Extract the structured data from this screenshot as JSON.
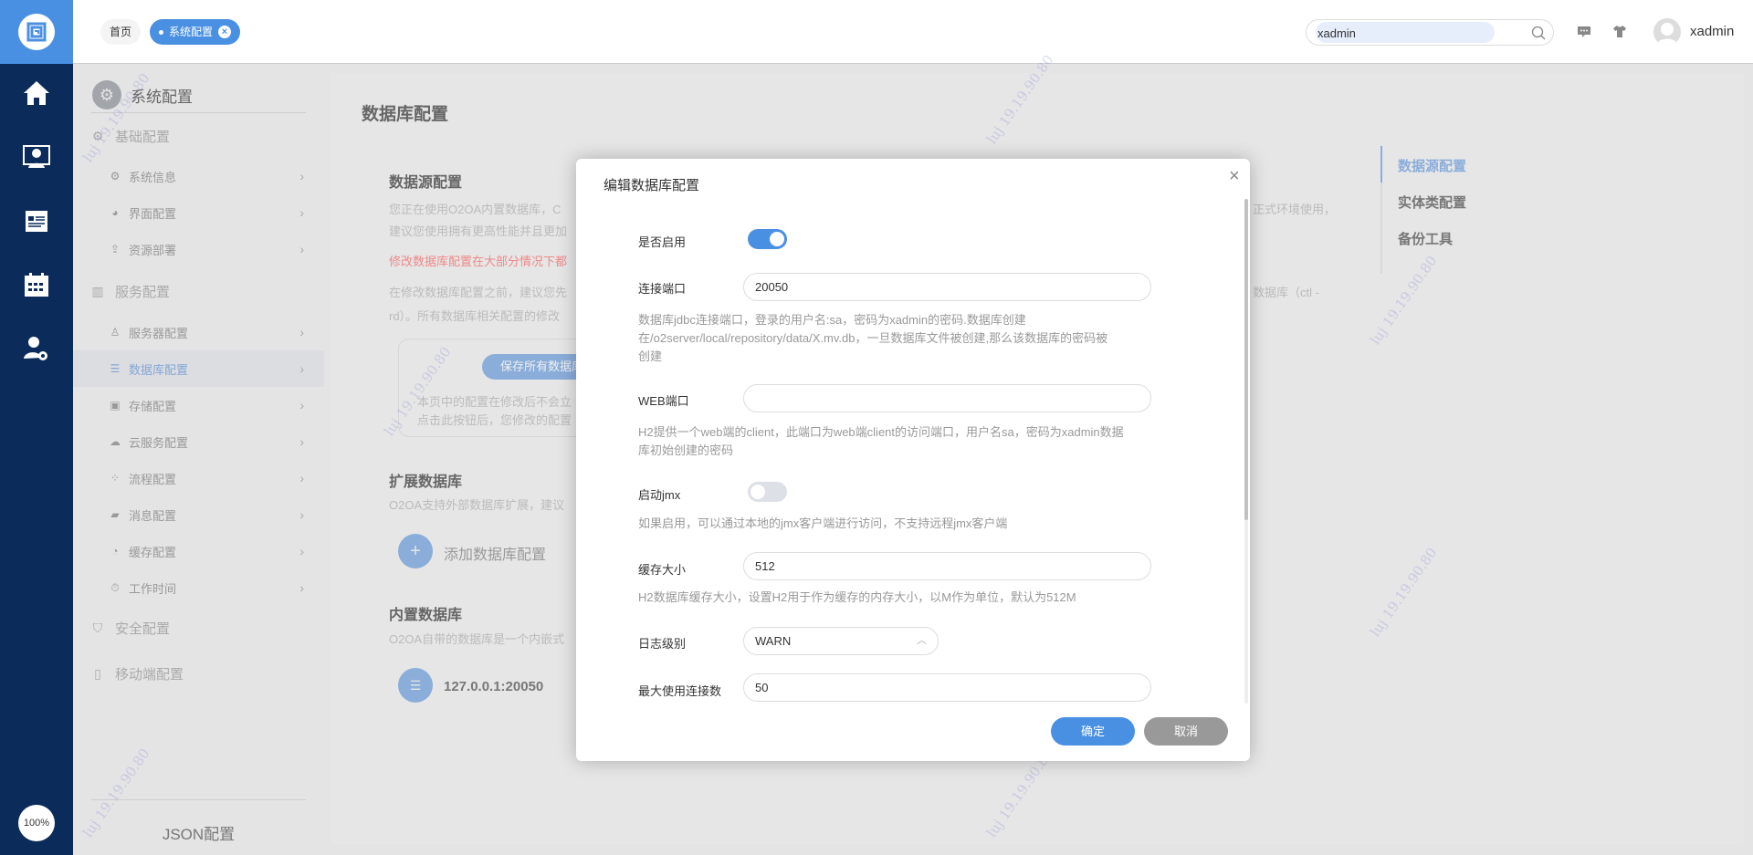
{
  "app": {
    "zoom_label": "100%",
    "watermark": "luj 19.19.90.80"
  },
  "topbar": {
    "tabs": [
      {
        "label": "首页"
      },
      {
        "label": "系统配置"
      }
    ],
    "search": {
      "value": "xadmin"
    },
    "user": {
      "name": "xadmin"
    }
  },
  "leftnav": {
    "icons": [
      "home-icon",
      "user-screen-icon",
      "news-icon",
      "calendar-icon",
      "user-settings-icon"
    ]
  },
  "sidebar": {
    "title": "系统配置",
    "groups": [
      {
        "label": "基础配置",
        "items": [
          {
            "label": "系统信息"
          },
          {
            "label": "界面配置"
          },
          {
            "label": "资源部署"
          }
        ]
      },
      {
        "label": "服务配置",
        "items": [
          {
            "label": "服务器配置"
          },
          {
            "label": "数据库配置",
            "active": true
          },
          {
            "label": "存储配置"
          },
          {
            "label": "云服务配置"
          },
          {
            "label": "流程配置"
          },
          {
            "label": "消息配置"
          },
          {
            "label": "缓存配置"
          },
          {
            "label": "工作时间"
          }
        ]
      },
      {
        "label": "安全配置"
      },
      {
        "label": "移动端配置"
      }
    ],
    "json_config": "JSON配置"
  },
  "main": {
    "title": "数据库配置",
    "datasource": {
      "heading": "数据源配置",
      "line1": "您正在使用O2OA内置数据库，C",
      "line1_end": "正式环境使用，",
      "line2": "建议您使用拥有更高性能并且更加",
      "warning": "修改数据库配置在大部分情况下都",
      "line3": "在修改数据库配置之前，建议您先",
      "line3_end": "数据库（ctl -",
      "line4": "rd）。所有数据库相关配置的修改",
      "save_button": "保存所有数据库",
      "save_note1": "本页中的配置在修改后不会立",
      "save_note2": "点击此按钮后，您修改的配置"
    },
    "extended": {
      "heading": "扩展数据库",
      "desc": "O2OA支持外部数据库扩展，建议",
      "add_label": "添加数据库配置"
    },
    "builtin": {
      "heading": "内置数据库",
      "desc": "O2OA自带的数据库是一个内嵌式",
      "db_address": "127.0.0.1:20050"
    },
    "right_nav": [
      {
        "label": "数据源配置",
        "active": true
      },
      {
        "label": "实体类配置"
      },
      {
        "label": "备份工具"
      }
    ]
  },
  "modal": {
    "title": "编辑数据库配置",
    "fields": {
      "enabled": {
        "label": "是否启用",
        "value": true
      },
      "port": {
        "label": "连接端口",
        "value": "20050",
        "desc": [
          "数据库jdbc连接端口，登录的用户名:sa，密码为xadmin的密码.数据库创建",
          "在/o2server/local/repository/data/X.mv.db，一旦数据库文件被创建,那么该数据库的密码被",
          "创建"
        ]
      },
      "web_port": {
        "label": "WEB端口",
        "value": "",
        "desc": [
          "H2提供一个web端的client，此端口为web端client的访问端口，用户名sa，密码为xadmin数据",
          "库初始创建的密码"
        ]
      },
      "jmx": {
        "label": "启动jmx",
        "value": false,
        "desc": "如果启用，可以通过本地的jmx客户端进行访问，不支持远程jmx客户端"
      },
      "cache": {
        "label": "缓存大小",
        "value": "512",
        "desc": "H2数据库缓存大小，设置H2用于作为缓存的内存大小，以M作为单位，默认为512M"
      },
      "log_level": {
        "label": "日志级别",
        "value": "WARN"
      },
      "max_conn": {
        "label": "最大使用连接数",
        "value": "50"
      }
    },
    "ok": "确定",
    "cancel": "取消"
  },
  "colors": {
    "accent": "#4a90e2",
    "nav": "#0b2c5a",
    "warning": "#e85a5a",
    "cancel": "#999999"
  }
}
